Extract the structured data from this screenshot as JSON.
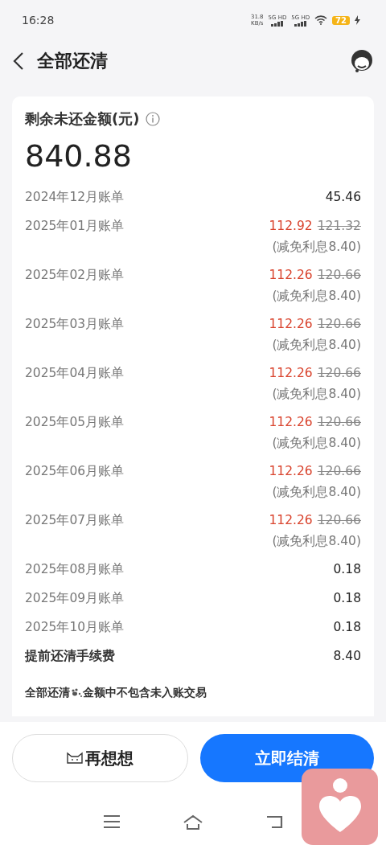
{
  "status_bar": {
    "time": "16:28",
    "speed": "31.8",
    "speed_unit": "KB/s",
    "networks": [
      "5G HD",
      "5G HD"
    ],
    "battery": "72"
  },
  "header": {
    "title": "全部还清"
  },
  "summary": {
    "label": "剩余未还金额(元)",
    "amount": "840.88"
  },
  "bills": [
    {
      "kind": "plain",
      "name": "2024年12月账单",
      "amount": "45.46"
    },
    {
      "kind": "discount",
      "name": "2025年01月账单",
      "amount": "112.92",
      "original": "121.32",
      "note": "(减免利息8.40)"
    },
    {
      "kind": "discount",
      "name": "2025年02月账单",
      "amount": "112.26",
      "original": "120.66",
      "note": "(减免利息8.40)"
    },
    {
      "kind": "discount",
      "name": "2025年03月账单",
      "amount": "112.26",
      "original": "120.66",
      "note": "(减免利息8.40)"
    },
    {
      "kind": "discount",
      "name": "2025年04月账单",
      "amount": "112.26",
      "original": "120.66",
      "note": "(减免利息8.40)"
    },
    {
      "kind": "discount",
      "name": "2025年05月账单",
      "amount": "112.26",
      "original": "120.66",
      "note": "(减免利息8.40)"
    },
    {
      "kind": "discount",
      "name": "2025年06月账单",
      "amount": "112.26",
      "original": "120.66",
      "note": "(减免利息8.40)"
    },
    {
      "kind": "discount",
      "name": "2025年07月账单",
      "amount": "112.26",
      "original": "120.66",
      "note": "(减免利息8.40)"
    },
    {
      "kind": "plain",
      "name": "2025年08月账单",
      "amount": "0.18"
    },
    {
      "kind": "plain",
      "name": "2025年09月账单",
      "amount": "0.18"
    },
    {
      "kind": "plain",
      "name": "2025年10月账单",
      "amount": "0.18"
    },
    {
      "kind": "fee",
      "name": "提前还清手续费",
      "amount": "8.40"
    }
  ],
  "notice": {
    "before": "全部还清",
    "after": "金额中不包含未入账交易"
  },
  "buttons": [
    {
      "kind": "secondary",
      "label": "再想想"
    },
    {
      "kind": "primary",
      "label": "立即结清"
    }
  ]
}
